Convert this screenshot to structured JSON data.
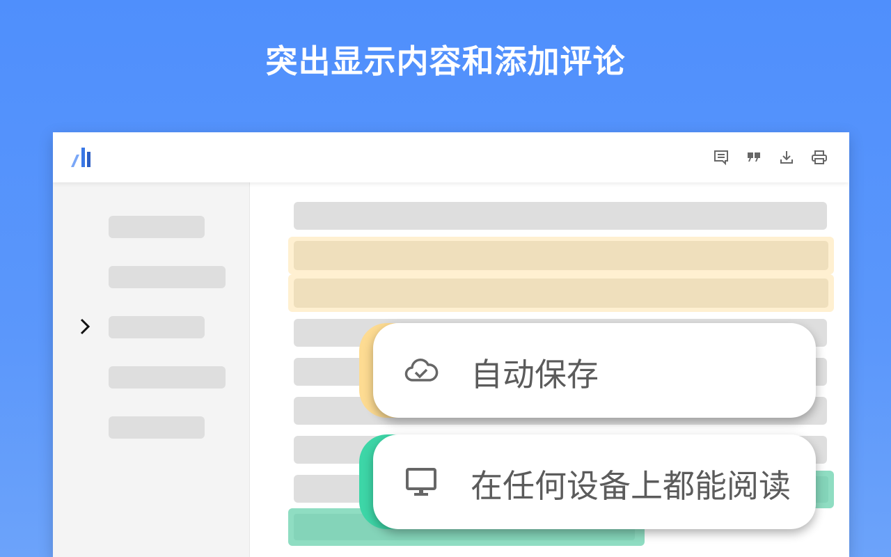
{
  "headline": "突出显示内容和添加评论",
  "toolbar": {
    "icons": [
      "comment-icon",
      "quote-icon",
      "download-icon",
      "print-icon"
    ]
  },
  "features": [
    {
      "label": "自动保存",
      "icon": "cloud-check-icon",
      "accent": "#fddb92"
    },
    {
      "label": "在任何设备上都能阅读",
      "icon": "monitor-icon",
      "accent": "#3dd6a7"
    }
  ],
  "colors": {
    "background": "#5090fb",
    "highlight_yellow": "#fff0d1",
    "highlight_green": "#8fddc2",
    "placeholder": "#dedede"
  }
}
